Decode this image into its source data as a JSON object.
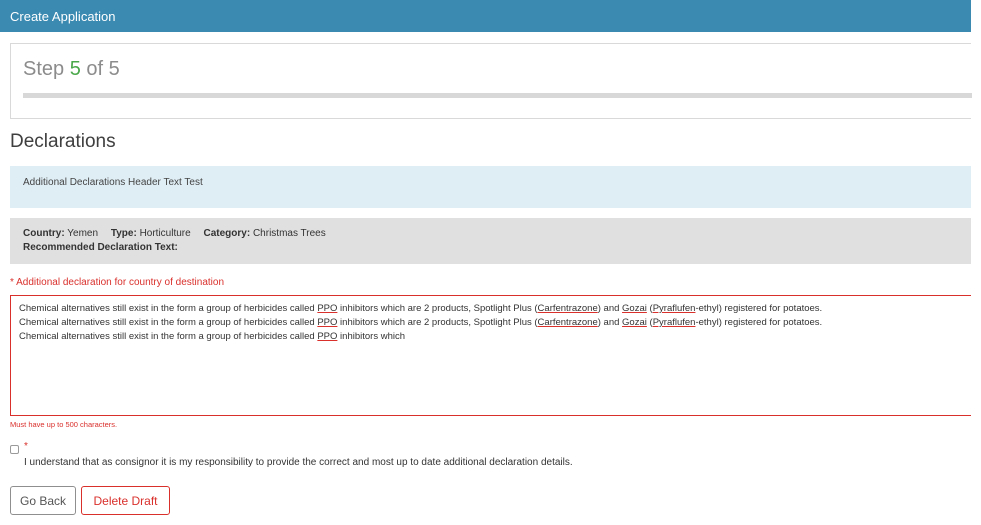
{
  "header": {
    "title": "Create Application"
  },
  "wizard": {
    "step_prefix": "Step",
    "current_step": "5",
    "step_sep": "of",
    "total_steps": "5",
    "progress_percent": 100
  },
  "section": {
    "title": "Declarations"
  },
  "info": {
    "header_text": "Additional Declarations Header Text Test"
  },
  "meta": {
    "country_label": "Country:",
    "country_value": "Yemen",
    "type_label": "Type:",
    "type_value": "Horticulture",
    "category_label": "Category:",
    "category_value": "Christmas Trees",
    "recommended_label": "Recommended Declaration Text:"
  },
  "declaration": {
    "label": "* Additional declaration for country of destination",
    "line1": {
      "a": "Chemical alternatives still exist in the form  a group of herbicides called ",
      "b": "PPO",
      "c": " inhibitors  which  are 2 products, Spotlight Plus (",
      "d": "Carfentrazone",
      "e": ") and ",
      "f": "Gozai",
      "g": " (",
      "h": "Pyraflufen",
      "i": "-ethyl) registered for potatoes."
    },
    "line2": {
      "a": "Chemical alternatives still exist in the form  a group of herbicides called ",
      "b": "PPO",
      "c": " inhibitors  which  are 2 products, Spotlight Plus (",
      "d": "Carfentrazone",
      "e": ") and ",
      "f": "Gozai",
      "g": " (",
      "h": "Pyraflufen",
      "i": "-ethyl) registered for potatoes."
    },
    "line3": {
      "a": "Chemical alternatives still exist in the form  a group of herbicides called ",
      "b": "PPO",
      "c": " inhibitors  which"
    },
    "help_text": "Must have up to 500 characters."
  },
  "consent": {
    "required_mark": "*",
    "text": "I understand that as consignor it is my responsibility to provide the correct and most up to date additional declaration details.",
    "checked": false
  },
  "buttons": {
    "back": "Go Back",
    "delete": "Delete Draft"
  },
  "colors": {
    "header_bg": "#3a8ab2",
    "error": "#d9302c",
    "info_bg": "#dfeef5",
    "meta_bg": "#e0e0e0",
    "step_current": "#4aa84a"
  }
}
